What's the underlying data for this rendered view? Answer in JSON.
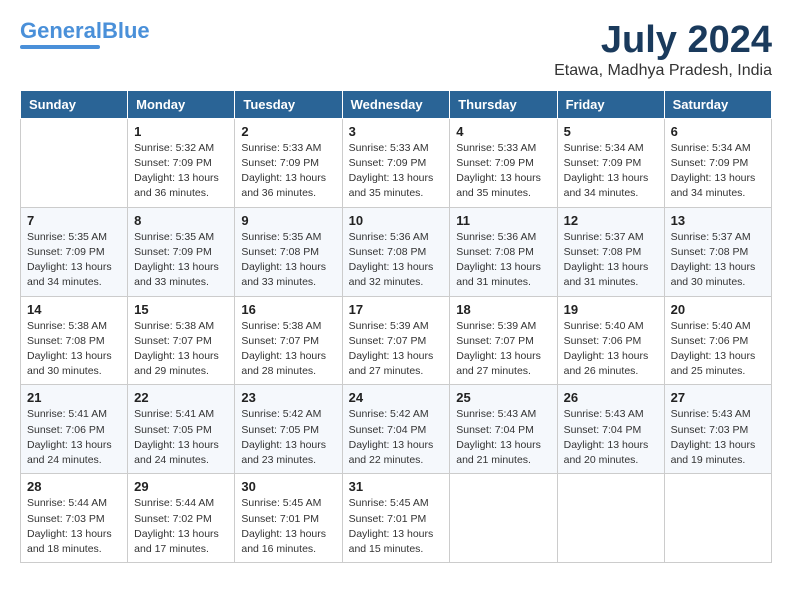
{
  "logo": {
    "line1": "General",
    "line2": "Blue"
  },
  "title": {
    "month_year": "July 2024",
    "location": "Etawa, Madhya Pradesh, India"
  },
  "headers": [
    "Sunday",
    "Monday",
    "Tuesday",
    "Wednesday",
    "Thursday",
    "Friday",
    "Saturday"
  ],
  "weeks": [
    [
      {
        "day": "",
        "info": ""
      },
      {
        "day": "1",
        "info": "Sunrise: 5:32 AM\nSunset: 7:09 PM\nDaylight: 13 hours\nand 36 minutes."
      },
      {
        "day": "2",
        "info": "Sunrise: 5:33 AM\nSunset: 7:09 PM\nDaylight: 13 hours\nand 36 minutes."
      },
      {
        "day": "3",
        "info": "Sunrise: 5:33 AM\nSunset: 7:09 PM\nDaylight: 13 hours\nand 35 minutes."
      },
      {
        "day": "4",
        "info": "Sunrise: 5:33 AM\nSunset: 7:09 PM\nDaylight: 13 hours\nand 35 minutes."
      },
      {
        "day": "5",
        "info": "Sunrise: 5:34 AM\nSunset: 7:09 PM\nDaylight: 13 hours\nand 34 minutes."
      },
      {
        "day": "6",
        "info": "Sunrise: 5:34 AM\nSunset: 7:09 PM\nDaylight: 13 hours\nand 34 minutes."
      }
    ],
    [
      {
        "day": "7",
        "info": "Sunrise: 5:35 AM\nSunset: 7:09 PM\nDaylight: 13 hours\nand 34 minutes."
      },
      {
        "day": "8",
        "info": "Sunrise: 5:35 AM\nSunset: 7:09 PM\nDaylight: 13 hours\nand 33 minutes."
      },
      {
        "day": "9",
        "info": "Sunrise: 5:35 AM\nSunset: 7:08 PM\nDaylight: 13 hours\nand 33 minutes."
      },
      {
        "day": "10",
        "info": "Sunrise: 5:36 AM\nSunset: 7:08 PM\nDaylight: 13 hours\nand 32 minutes."
      },
      {
        "day": "11",
        "info": "Sunrise: 5:36 AM\nSunset: 7:08 PM\nDaylight: 13 hours\nand 31 minutes."
      },
      {
        "day": "12",
        "info": "Sunrise: 5:37 AM\nSunset: 7:08 PM\nDaylight: 13 hours\nand 31 minutes."
      },
      {
        "day": "13",
        "info": "Sunrise: 5:37 AM\nSunset: 7:08 PM\nDaylight: 13 hours\nand 30 minutes."
      }
    ],
    [
      {
        "day": "14",
        "info": "Sunrise: 5:38 AM\nSunset: 7:08 PM\nDaylight: 13 hours\nand 30 minutes."
      },
      {
        "day": "15",
        "info": "Sunrise: 5:38 AM\nSunset: 7:07 PM\nDaylight: 13 hours\nand 29 minutes."
      },
      {
        "day": "16",
        "info": "Sunrise: 5:38 AM\nSunset: 7:07 PM\nDaylight: 13 hours\nand 28 minutes."
      },
      {
        "day": "17",
        "info": "Sunrise: 5:39 AM\nSunset: 7:07 PM\nDaylight: 13 hours\nand 27 minutes."
      },
      {
        "day": "18",
        "info": "Sunrise: 5:39 AM\nSunset: 7:07 PM\nDaylight: 13 hours\nand 27 minutes."
      },
      {
        "day": "19",
        "info": "Sunrise: 5:40 AM\nSunset: 7:06 PM\nDaylight: 13 hours\nand 26 minutes."
      },
      {
        "day": "20",
        "info": "Sunrise: 5:40 AM\nSunset: 7:06 PM\nDaylight: 13 hours\nand 25 minutes."
      }
    ],
    [
      {
        "day": "21",
        "info": "Sunrise: 5:41 AM\nSunset: 7:06 PM\nDaylight: 13 hours\nand 24 minutes."
      },
      {
        "day": "22",
        "info": "Sunrise: 5:41 AM\nSunset: 7:05 PM\nDaylight: 13 hours\nand 24 minutes."
      },
      {
        "day": "23",
        "info": "Sunrise: 5:42 AM\nSunset: 7:05 PM\nDaylight: 13 hours\nand 23 minutes."
      },
      {
        "day": "24",
        "info": "Sunrise: 5:42 AM\nSunset: 7:04 PM\nDaylight: 13 hours\nand 22 minutes."
      },
      {
        "day": "25",
        "info": "Sunrise: 5:43 AM\nSunset: 7:04 PM\nDaylight: 13 hours\nand 21 minutes."
      },
      {
        "day": "26",
        "info": "Sunrise: 5:43 AM\nSunset: 7:04 PM\nDaylight: 13 hours\nand 20 minutes."
      },
      {
        "day": "27",
        "info": "Sunrise: 5:43 AM\nSunset: 7:03 PM\nDaylight: 13 hours\nand 19 minutes."
      }
    ],
    [
      {
        "day": "28",
        "info": "Sunrise: 5:44 AM\nSunset: 7:03 PM\nDaylight: 13 hours\nand 18 minutes."
      },
      {
        "day": "29",
        "info": "Sunrise: 5:44 AM\nSunset: 7:02 PM\nDaylight: 13 hours\nand 17 minutes."
      },
      {
        "day": "30",
        "info": "Sunrise: 5:45 AM\nSunset: 7:01 PM\nDaylight: 13 hours\nand 16 minutes."
      },
      {
        "day": "31",
        "info": "Sunrise: 5:45 AM\nSunset: 7:01 PM\nDaylight: 13 hours\nand 15 minutes."
      },
      {
        "day": "",
        "info": ""
      },
      {
        "day": "",
        "info": ""
      },
      {
        "day": "",
        "info": ""
      }
    ]
  ]
}
